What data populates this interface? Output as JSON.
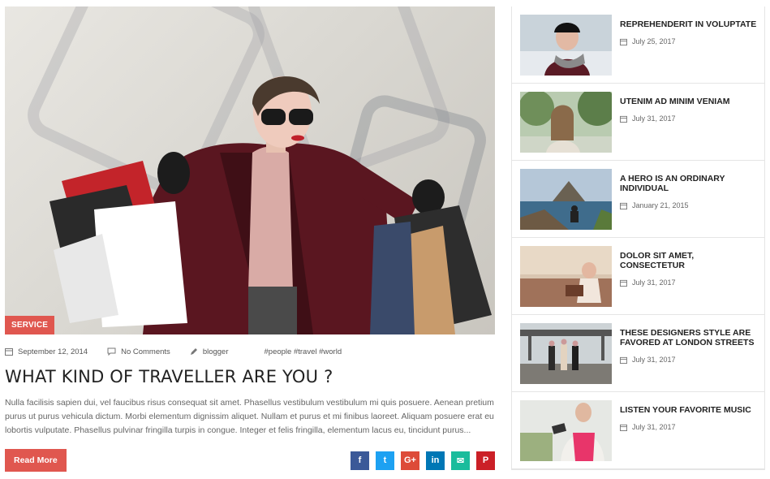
{
  "post": {
    "category": "SERVICE",
    "date": "September 12, 2014",
    "comments": "No Comments",
    "author": "blogger",
    "tags": "#people #travel #world",
    "title": "WHAT KIND OF TRAVELLER ARE YOU ?",
    "excerpt": "Nulla facilisis sapien dui, vel faucibus risus consequat sit amet. Phasellus vestibulum vestibulum mi quis posuere. Aenean pretium purus ut purus vehicula dictum. Morbi elementum dignissim aliquet. Nullam et purus et mi finibus laoreet. Aliquam posuere erat eu lobortis vulputate. Phasellus pulvinar fringilla turpis in congue. Integer et felis fringilla, elementum lacus eu, tincidunt purus...",
    "read_more": "Read More"
  },
  "share": [
    {
      "icon": "facebook-icon",
      "glyph": "f",
      "color": "#3b5998"
    },
    {
      "icon": "twitter-icon",
      "glyph": "t",
      "color": "#1da1f2"
    },
    {
      "icon": "google-plus-icon",
      "glyph": "G+",
      "color": "#dd4b39"
    },
    {
      "icon": "linkedin-icon",
      "glyph": "in",
      "color": "#0077b5"
    },
    {
      "icon": "email-icon",
      "glyph": "✉",
      "color": "#1abc9c"
    },
    {
      "icon": "pinterest-icon",
      "glyph": "P",
      "color": "#cb2027"
    }
  ],
  "sidebar": {
    "items": [
      {
        "title": "REPREHENDERIT IN VOLUPTATE",
        "date": "July 25, 2017"
      },
      {
        "title": "UTENIM AD MINIM VENIAM",
        "date": "July 31, 2017"
      },
      {
        "title": "A HERO IS AN ORDINARY INDIVIDUAL",
        "date": "January 21, 2015"
      },
      {
        "title": "DOLOR SIT AMET, CONSECTETUR",
        "date": "July 31, 2017"
      },
      {
        "title": "THESE DESIGNERS STYLE ARE FAVORED AT LONDON STREETS",
        "date": "July 31, 2017"
      },
      {
        "title": "LISTEN YOUR FAVORITE MUSIC",
        "date": "July 31, 2017"
      }
    ]
  },
  "colors": {
    "accent": "#e0574f"
  }
}
